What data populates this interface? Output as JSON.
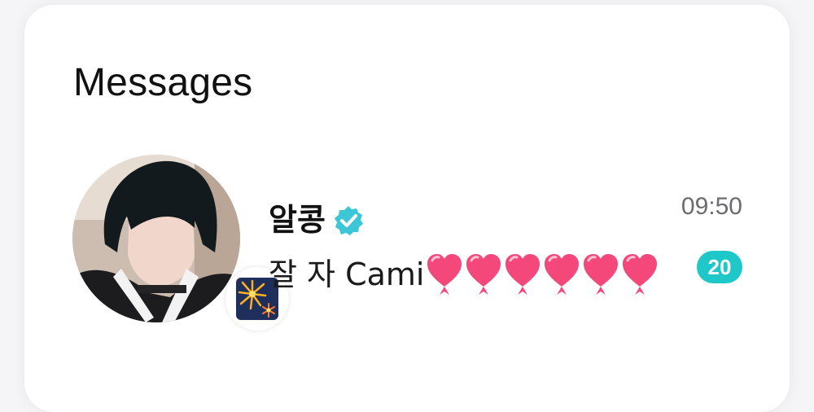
{
  "header": {
    "title": "Messages"
  },
  "conversation": {
    "name": "알콩",
    "verified_icon": "verified-check-icon",
    "time": "09:50",
    "preview_text": "잘 자 Cami",
    "preview_hearts": 6,
    "unread_count": "20",
    "avatar_badge_icon": "fireworks-icon"
  },
  "colors": {
    "accent": "#1ec8c8",
    "verified": "#3cc6d6",
    "heart": "#f4487a"
  }
}
